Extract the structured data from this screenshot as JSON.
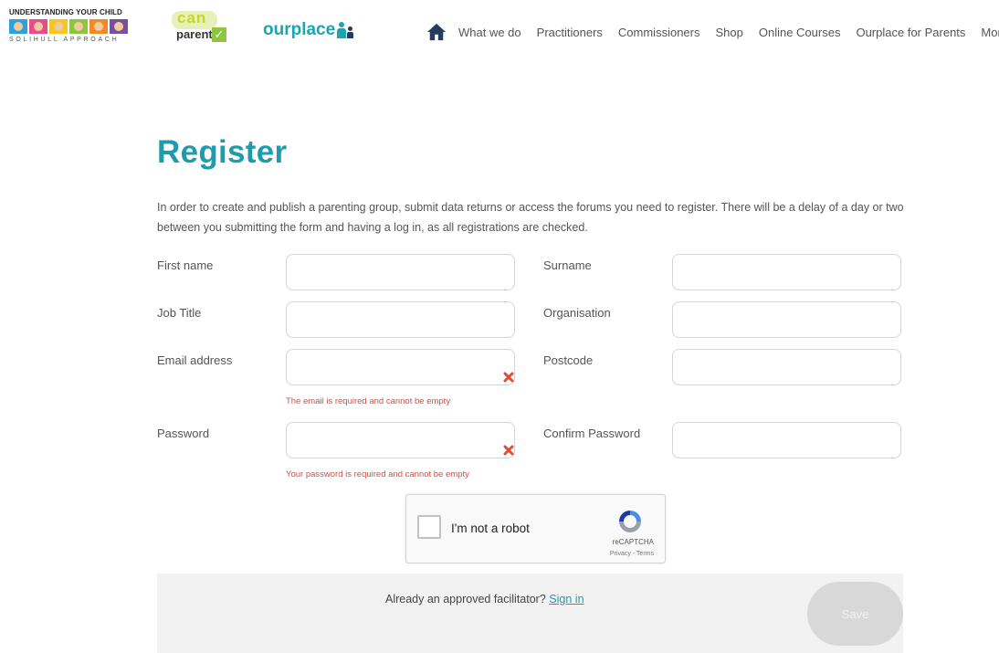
{
  "header": {
    "uyc_logo": {
      "title": "UNDERSTANDING YOUR CHILD",
      "subtitle": "SOLIHULL APPROACH",
      "tile_colors": [
        "#29a3dc",
        "#e84c8b",
        "#f7c51e",
        "#8cc63f",
        "#f48a23",
        "#7b4fa0"
      ]
    },
    "canparent_logo": {
      "top": "can",
      "bottom": "parent",
      "accent": "#8ec63f"
    },
    "ourplace_logo": {
      "text": "ourplace",
      "color": "#1aa5b3"
    },
    "nav": {
      "home_icon": "home-icon",
      "items": [
        "What we do",
        "Practitioners",
        "Commissioners",
        "Shop",
        "Online Courses",
        "Ourplace for Parents"
      ],
      "more": "More"
    }
  },
  "page": {
    "title": "Register",
    "intro": "In order to create and publish a parenting group, submit data returns or access the forums you need to register. There will be a delay of a day or two between you submitting the form and having a log in, as all registrations are checked."
  },
  "form": {
    "first_name": {
      "label": "First name",
      "value": ""
    },
    "surname": {
      "label": "Surname",
      "value": ""
    },
    "job_title": {
      "label": "Job Title",
      "value": ""
    },
    "organisation": {
      "label": "Organisation",
      "value": ""
    },
    "email": {
      "label": "Email address",
      "value": "",
      "error": "The email is required and cannot be empty"
    },
    "postcode": {
      "label": "Postcode",
      "value": ""
    },
    "password": {
      "label": "Password",
      "value": "",
      "error": "Your password is required and cannot be empty"
    },
    "confirm_password": {
      "label": "Confirm Password",
      "value": ""
    }
  },
  "captcha": {
    "label": "I'm not a robot",
    "brand": "reCAPTCHA",
    "links": "Privacy - Terms",
    "checked": false
  },
  "footer": {
    "already_text": "Already an approved facilitator?",
    "signin_link": "Sign in",
    "save_button": "Save"
  },
  "colors": {
    "accent": "#1e9cac",
    "error": "#e04a3a",
    "button_disabled": "#d8d8d8"
  }
}
